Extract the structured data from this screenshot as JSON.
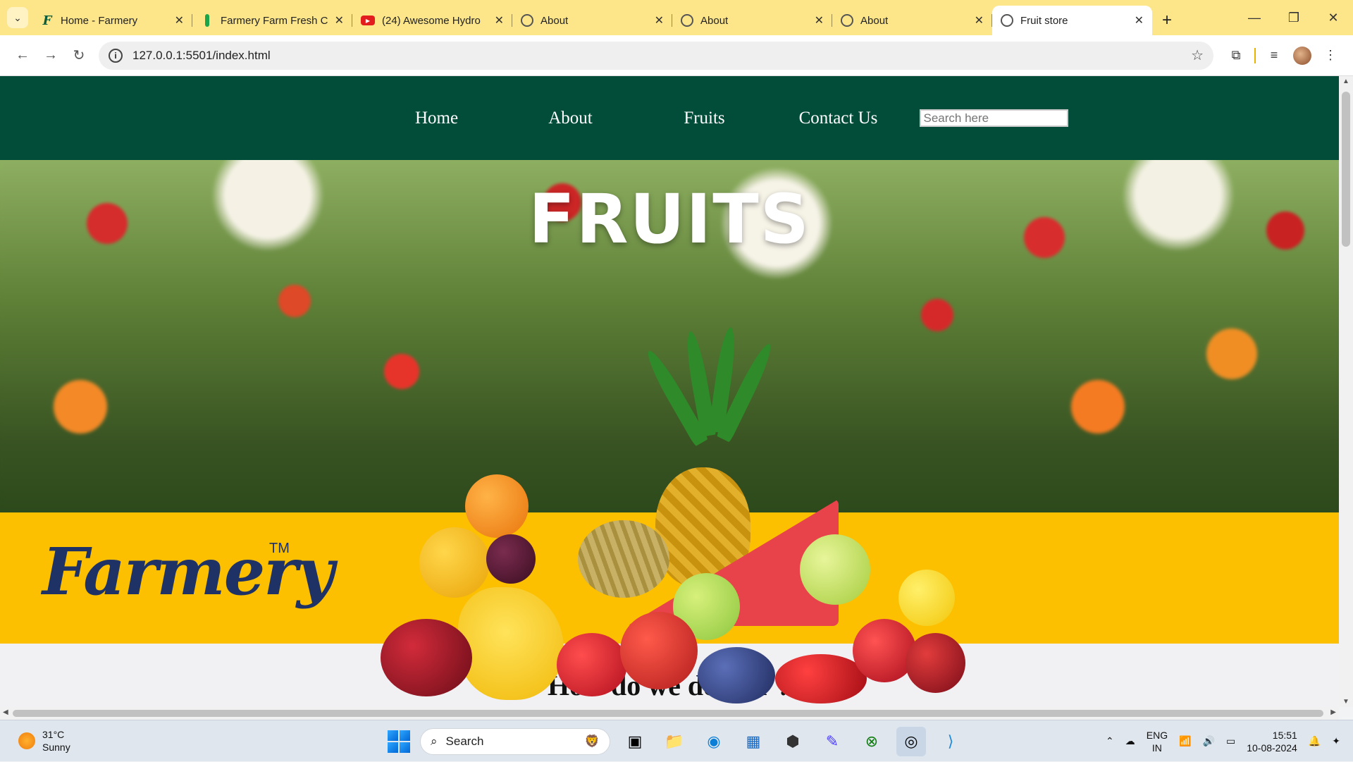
{
  "browser": {
    "tabs": [
      {
        "title": "Home - Farmery",
        "icon": "farmery-f-icon"
      },
      {
        "title": "Farmery Farm Fresh C",
        "icon": "farmery-leaf-icon"
      },
      {
        "title": "(24) Awesome Hydro",
        "icon": "youtube-icon"
      },
      {
        "title": "About",
        "icon": "globe-icon"
      },
      {
        "title": "About",
        "icon": "globe-icon"
      },
      {
        "title": "About",
        "icon": "globe-icon"
      },
      {
        "title": "Fruit store",
        "icon": "globe-icon",
        "active": true
      }
    ],
    "url": "127.0.0.1:5501/index.html"
  },
  "page": {
    "nav": {
      "links": [
        "Home",
        "About",
        "Fruits",
        "Contact Us"
      ],
      "search_placeholder": "Search here"
    },
    "hero_title": "FRUITS",
    "brand": {
      "name": "Farmery",
      "tm": "TM"
    },
    "section_heading": "How do we deliver ?",
    "colors": {
      "nav_bg": "#014d3a",
      "band_bg": "#fcc000",
      "brand_text": "#1f3266"
    }
  },
  "taskbar": {
    "weather": {
      "temp": "31°C",
      "condition": "Sunny"
    },
    "search_label": "Search",
    "lang": {
      "line1": "ENG",
      "line2": "IN"
    },
    "time": "15:51",
    "date": "10-08-2024"
  }
}
